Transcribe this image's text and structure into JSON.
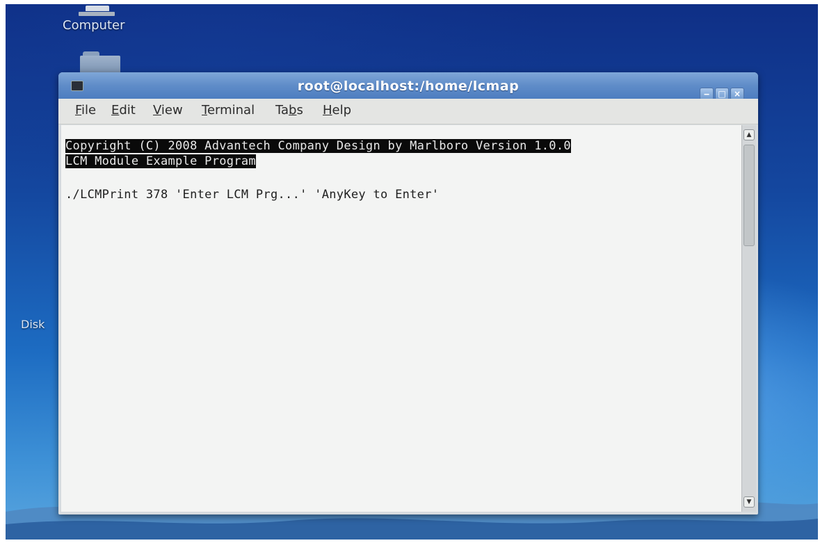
{
  "desktop": {
    "icons": [
      {
        "label": "Computer",
        "icon": "computer-icon"
      },
      {
        "label": "",
        "icon": "folder-icon"
      },
      {
        "label": "Disk",
        "icon": "disk-icon"
      }
    ],
    "background_colors": {
      "top": "#0f2f86",
      "bottom": "#5aa6df"
    }
  },
  "window": {
    "title": "root@localhost:/home/lcmap",
    "controls": {
      "minimize": "‒",
      "maximize": "□",
      "close": "×"
    },
    "menu": [
      "File",
      "Edit",
      "View",
      "Terminal",
      "Tabs",
      "Help"
    ],
    "menu_mnemonics": [
      "F",
      "E",
      "V",
      "T",
      "b",
      "H"
    ]
  },
  "terminal": {
    "lines": [
      {
        "text": "Copyright (C) 2008 Advantech Company Design by Marlboro Version 1.0.0",
        "highlighted": true
      },
      {
        "text": "LCM Module Example Program",
        "highlighted": true
      },
      {
        "text": "",
        "highlighted": false
      },
      {
        "text": "./LCMPrint 378 'Enter LCM Prg...' 'AnyKey to Enter'",
        "highlighted": false
      }
    ],
    "scroll_position": 0.0
  },
  "colors": {
    "titlebar": "#5f8cc8",
    "terminal_bg": "#f3f4f3",
    "highlight_bg": "#0a0a0a"
  }
}
